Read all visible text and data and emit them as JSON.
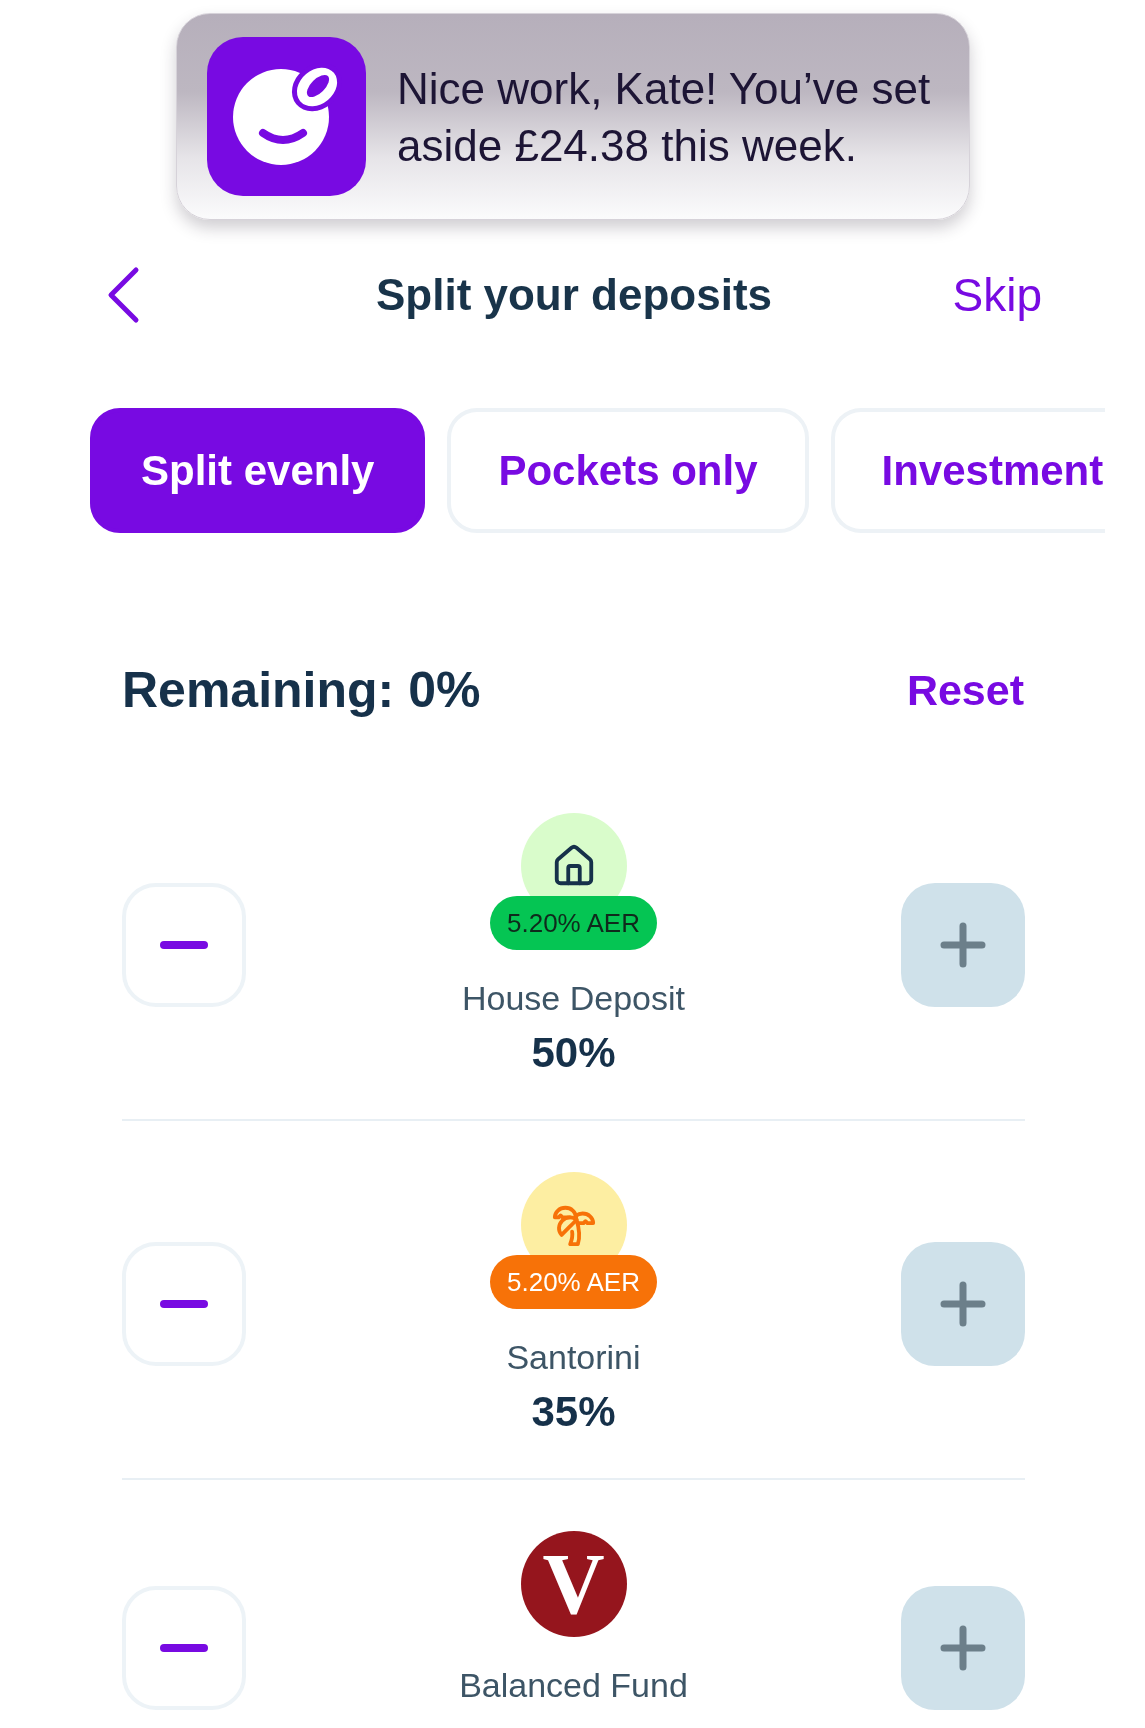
{
  "notification": {
    "message": "Nice work, Kate! You’ve set aside £24.38 this week."
  },
  "header": {
    "title": "Split your deposits",
    "action": "Skip"
  },
  "tabs": [
    {
      "label": "Split evenly",
      "selected": true
    },
    {
      "label": "Pockets only",
      "selected": false
    },
    {
      "label": "Investment",
      "selected": false
    }
  ],
  "summary": {
    "remaining": "Remaining: 0%",
    "action": "Reset"
  },
  "allocations": [
    {
      "name": "House Deposit",
      "percent": "50%",
      "badge": {
        "text": "5.20% AER",
        "color": "#05c553"
      },
      "increase_disabled": true
    },
    {
      "name": "Santorini",
      "percent": "35%",
      "badge": {
        "text": "5.20% AER",
        "color": "#f77208"
      },
      "increase_disabled": true
    },
    {
      "name": "Balanced Fund",
      "logo": "V",
      "increase_disabled": true
    }
  ]
}
